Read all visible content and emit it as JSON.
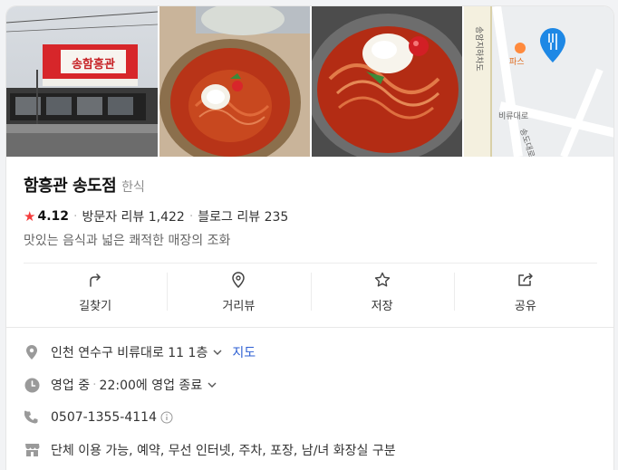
{
  "place": {
    "name": "함흥관 송도점",
    "category": "한식",
    "rating": "4.12",
    "visitor_reviews": "방문자 리뷰 1,422",
    "blog_reviews": "블로그 리뷰 235",
    "description": "맛있는 음식과 넓은 쾌적한 매장의 조화"
  },
  "photos": {
    "storefront_sign": "송함흥관",
    "map_label_road1": "송암지하차도",
    "map_label_road2": "비류대로",
    "map_label_road3": "송도대로",
    "map_label_poi": "파스"
  },
  "actions": [
    {
      "label": "길찾기",
      "icon": "directions-icon"
    },
    {
      "label": "거리뷰",
      "icon": "location-pin-icon"
    },
    {
      "label": "저장",
      "icon": "star-icon"
    },
    {
      "label": "공유",
      "icon": "share-icon"
    }
  ],
  "details": {
    "address": "인천 연수구 비류대로 11 1층",
    "map_link": "지도",
    "status": "영업 중",
    "hours": "22:00에 영업 종료",
    "phone": "0507-1355-4114",
    "amenities": "단체 이용 가능, 예약, 무선 인터넷, 주차, 포장, 남/녀 화장실 구분"
  },
  "colors": {
    "accent_star": "#f53c3c",
    "link": "#2d5fd3",
    "map_pin": "#1e88e5"
  }
}
